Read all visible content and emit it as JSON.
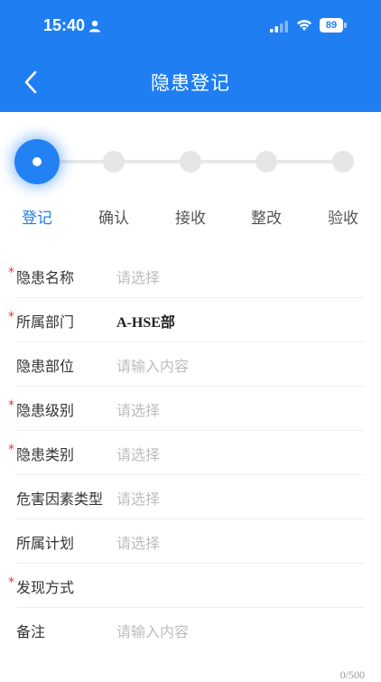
{
  "status_bar": {
    "time": "15:40",
    "battery": "89"
  },
  "header": {
    "title": "隐患登记"
  },
  "colors": {
    "primary": "#1f7ef2",
    "required": "#e23b3b"
  },
  "stepper": {
    "steps": [
      {
        "label": "登记",
        "active": true
      },
      {
        "label": "确认",
        "active": false
      },
      {
        "label": "接收",
        "active": false
      },
      {
        "label": "整改",
        "active": false
      },
      {
        "label": "验收",
        "active": false
      }
    ]
  },
  "form": {
    "fields": [
      {
        "label": "隐患名称",
        "required": true,
        "value": "",
        "placeholder": "请选择"
      },
      {
        "label": "所属部门",
        "required": true,
        "value": "A-HSE部",
        "placeholder": ""
      },
      {
        "label": "隐患部位",
        "required": false,
        "value": "",
        "placeholder": "请输入内容"
      },
      {
        "label": "隐患级别",
        "required": true,
        "value": "",
        "placeholder": "请选择"
      },
      {
        "label": "隐患类别",
        "required": true,
        "value": "",
        "placeholder": "请选择"
      },
      {
        "label": "危害因素类型",
        "required": false,
        "value": "",
        "placeholder": "请选择"
      },
      {
        "label": "所属计划",
        "required": false,
        "value": "",
        "placeholder": "请选择"
      },
      {
        "label": "发现方式",
        "required": true,
        "value": "",
        "placeholder": ""
      },
      {
        "label": "备注",
        "required": false,
        "value": "",
        "placeholder": "请输入内容"
      }
    ],
    "remark_counter": "0/500"
  }
}
